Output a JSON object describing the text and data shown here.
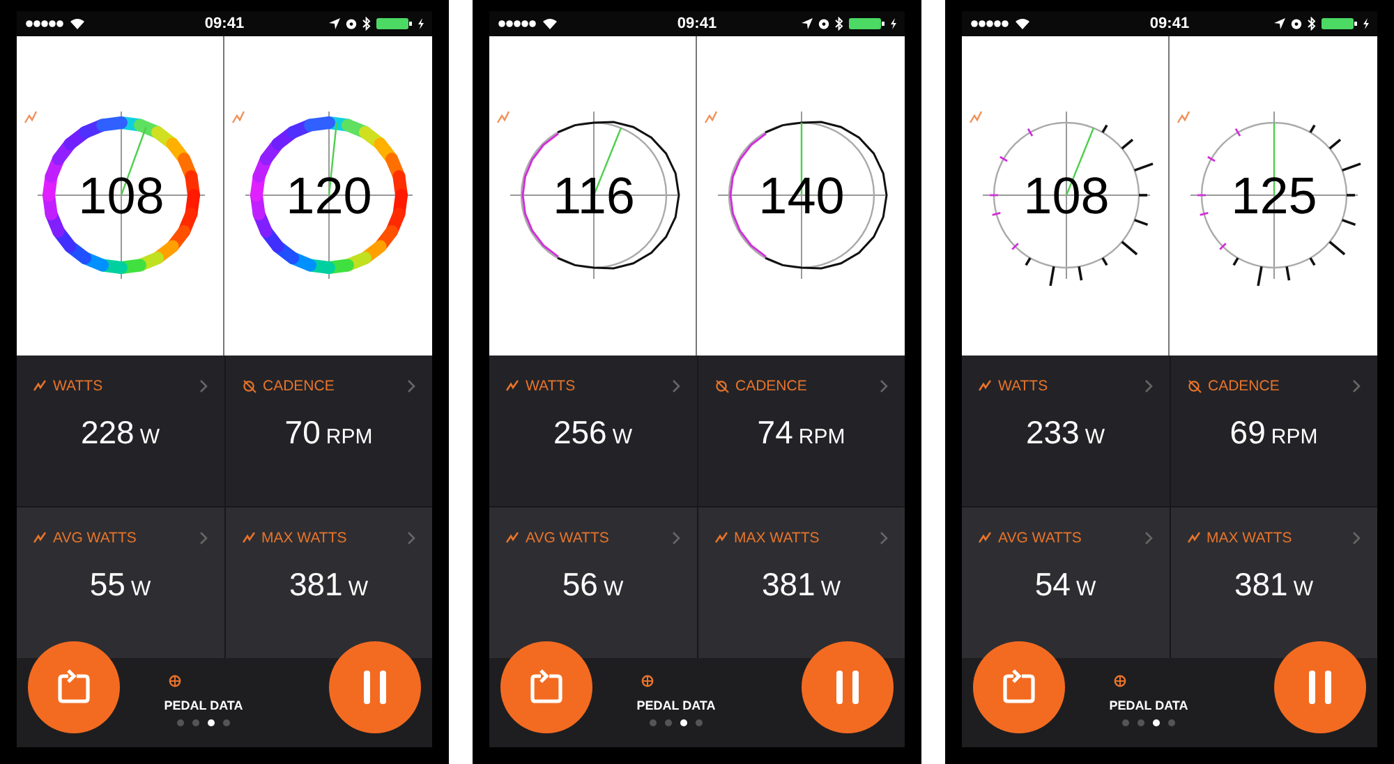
{
  "phones": [
    {
      "status_bar": {
        "time": "09:41"
      },
      "gauges": [
        {
          "kind": "rainbow",
          "value": "108"
        },
        {
          "kind": "rainbow",
          "value": "120"
        }
      ],
      "tiles": [
        {
          "kind": "power",
          "label": "WATTS",
          "value": "228",
          "unit": "W"
        },
        {
          "kind": "cadence",
          "label": "CADENCE",
          "value": "70",
          "unit": "RPM"
        },
        {
          "kind": "power",
          "label": "AVG WATTS",
          "value": "55",
          "unit": "W"
        },
        {
          "kind": "power",
          "label": "MAX WATTS",
          "value": "381",
          "unit": "W"
        }
      ],
      "page_title": "PEDAL DATA",
      "page_dots": [
        {
          "selected": false
        },
        {
          "selected": false
        },
        {
          "selected": true
        },
        {
          "selected": false
        }
      ]
    },
    {
      "status_bar": {
        "time": "09:41"
      },
      "gauges": [
        {
          "kind": "outline",
          "value": "116"
        },
        {
          "kind": "outline",
          "value": "140"
        }
      ],
      "tiles": [
        {
          "kind": "power",
          "label": "WATTS",
          "value": "256",
          "unit": "W"
        },
        {
          "kind": "cadence",
          "label": "CADENCE",
          "value": "74",
          "unit": "RPM"
        },
        {
          "kind": "power",
          "label": "AVG WATTS",
          "value": "56",
          "unit": "W"
        },
        {
          "kind": "power",
          "label": "MAX WATTS",
          "value": "381",
          "unit": "W"
        }
      ],
      "page_title": "PEDAL DATA",
      "page_dots": [
        {
          "selected": false
        },
        {
          "selected": false
        },
        {
          "selected": true
        },
        {
          "selected": false
        }
      ]
    },
    {
      "status_bar": {
        "time": "09:41"
      },
      "gauges": [
        {
          "kind": "ticks",
          "value": "108"
        },
        {
          "kind": "ticks",
          "value": "125"
        }
      ],
      "tiles": [
        {
          "kind": "power",
          "label": "WATTS",
          "value": "233",
          "unit": "W"
        },
        {
          "kind": "cadence",
          "label": "CADENCE",
          "value": "69",
          "unit": "RPM"
        },
        {
          "kind": "power",
          "label": "AVG WATTS",
          "value": "54",
          "unit": "W"
        },
        {
          "kind": "power",
          "label": "MAX WATTS",
          "value": "381",
          "unit": "W"
        }
      ],
      "page_title": "PEDAL DATA",
      "page_dots": [
        {
          "selected": false
        },
        {
          "selected": false
        },
        {
          "selected": true
        },
        {
          "selected": false
        }
      ]
    }
  ]
}
